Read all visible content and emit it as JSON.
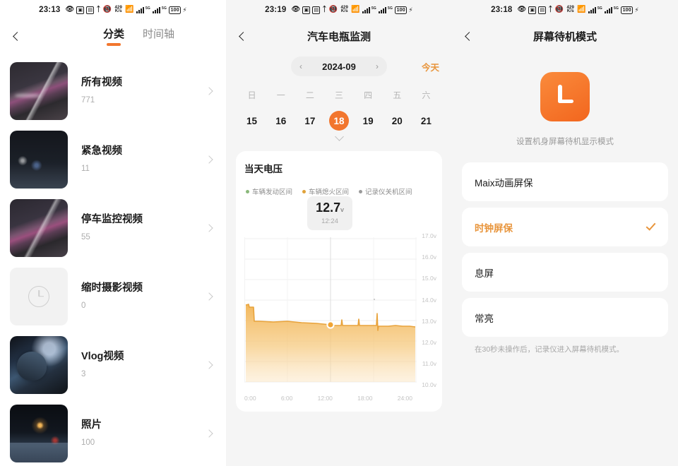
{
  "panels": {
    "media": {
      "statusbar": {
        "time": "23:13",
        "icons": [
          "eye-icon",
          "boxed-icon-a",
          "boxed-icon-b",
          "bluetooth-icon",
          "vibrate-icon",
          "network-speed-icon",
          "wifi-icon",
          "signal-icon-1",
          "signal-icon-2",
          "battery-icon",
          "charging-bolt-icon"
        ],
        "battery": "100"
      },
      "back": "‹",
      "tabs": [
        {
          "label": "分类",
          "active": true
        },
        {
          "label": "时间轴",
          "active": false
        }
      ],
      "items": [
        {
          "title": "所有视频",
          "count": "771",
          "thumb": "t1"
        },
        {
          "title": "紧急视频",
          "count": "11",
          "thumb": "t2"
        },
        {
          "title": "停车监控视频",
          "count": "55",
          "thumb": "t3"
        },
        {
          "title": "缩时摄影视频",
          "count": "0",
          "thumb": "placeholder"
        },
        {
          "title": "Vlog视频",
          "count": "3",
          "thumb": "t4"
        },
        {
          "title": "照片",
          "count": "100",
          "thumb": "t5"
        }
      ]
    },
    "battery_monitor": {
      "statusbar": {
        "time": "23:19",
        "battery": "100"
      },
      "title": "汽车电瓶监测",
      "calendar": {
        "month": "2024-09",
        "prev_arrow": "‹",
        "next_arrow": "›",
        "today_label": "今天",
        "weekdays": [
          "日",
          "一",
          "二",
          "三",
          "四",
          "五",
          "六"
        ],
        "dates": [
          "15",
          "16",
          "17",
          "18",
          "19",
          "20",
          "21"
        ],
        "selected_date": "18"
      },
      "chart_card": {
        "title": "当天电压",
        "tooltip": {
          "value": "12.7",
          "unit": "v",
          "time": "12:24"
        }
      }
    },
    "standby": {
      "statusbar": {
        "time": "23:18",
        "battery": "100"
      },
      "title": "屏幕待机模式",
      "hero_subtitle": "设置机身屏幕待机显示模式",
      "options": [
        {
          "label": "Maix动画屏保",
          "selected": false
        },
        {
          "label": "时钟屏保",
          "selected": true
        },
        {
          "label": "息屏",
          "selected": false
        },
        {
          "label": "常亮",
          "selected": false
        }
      ],
      "note": "在30秒未操作后，记录仪进入屏幕待机模式。"
    }
  },
  "colors": {
    "accent_orange": "#f2762e",
    "accent_amber": "#e8953c",
    "chart_line": "#e8a33c",
    "legend_green": "#8ab87a",
    "legend_orange": "#e0a23a",
    "legend_gray": "#9a9a9a",
    "panel_bg": "#f5f5f5",
    "card_bg": "#ffffff"
  },
  "chart_data": {
    "type": "area",
    "title": "当天电压",
    "xlabel": "",
    "ylabel": "",
    "xlim": [
      0,
      24
    ],
    "ylim": [
      10.0,
      17.0
    ],
    "grid": true,
    "legend_position": "top",
    "x_ticks": [
      "0:00",
      "6:00",
      "12:00",
      "18:00",
      "24:00"
    ],
    "y_ticks": [
      "10.0v",
      "11.0v",
      "12.0v",
      "13.0v",
      "14.0v",
      "15.0v",
      "16.0v",
      "17.0v"
    ],
    "legend": [
      {
        "name": "车辆发动区间",
        "color": "#8ab87a"
      },
      {
        "name": "车辆熄火区间",
        "color": "#e0a23a"
      },
      {
        "name": "记录仪关机区间",
        "color": "#9a9a9a"
      }
    ],
    "marker": {
      "x": 12.4,
      "y": 12.7,
      "label": "12.7v",
      "time": "12:24"
    },
    "series": [
      {
        "name": "电压",
        "color": "#e8a33c",
        "x": [
          0.0,
          0.4,
          0.5,
          1.2,
          1.3,
          2.0,
          4.0,
          6.0,
          7.0,
          8.0,
          10.0,
          12.0,
          12.4,
          13.0,
          13.4,
          13.5,
          13.6,
          14.5,
          15.8,
          15.9,
          16.0,
          17.0,
          18.4,
          18.5,
          18.6,
          18.7,
          19.0,
          20.0,
          21.0,
          22.0,
          23.0,
          24.0
        ],
        "y": [
          13.7,
          13.72,
          13.6,
          13.6,
          12.92,
          12.9,
          12.88,
          12.92,
          12.9,
          12.87,
          12.82,
          12.74,
          12.7,
          12.72,
          12.72,
          13.0,
          12.72,
          12.72,
          12.72,
          13.02,
          12.72,
          12.72,
          12.7,
          13.25,
          12.45,
          12.7,
          12.7,
          12.7,
          12.72,
          12.7,
          12.7,
          12.68
        ]
      }
    ]
  }
}
